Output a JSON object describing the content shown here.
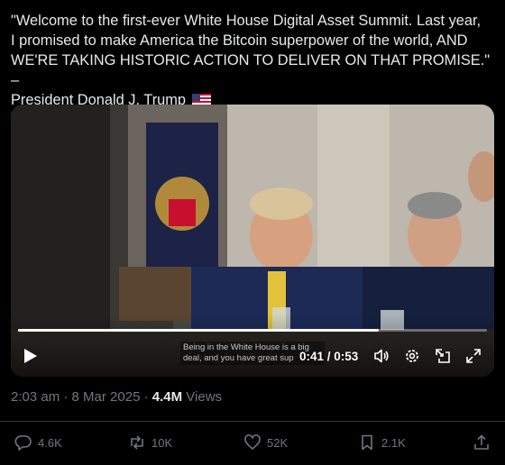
{
  "tweet": {
    "text_line1": "\"Welcome to the first-ever White House Digital Asset Summit. Last year,",
    "text_line2": "I promised to make America the Bitcoin superpower of the world, AND",
    "text_line3": "WE'RE TAKING HISTORIC ACTION TO DELIVER ON THAT PROMISE.\" –",
    "text_line4": "President Donald J. Trump",
    "flag_icon": "us-flag-icon"
  },
  "video": {
    "caption": "Being in the White House is a big deal, and you have great sup",
    "current_time": "0:41",
    "separator": " / ",
    "duration": "0:53",
    "progress": 0.77,
    "icons": [
      "play-icon",
      "volume-icon",
      "settings-icon",
      "fullscreen-exit-icon",
      "expand-icon"
    ]
  },
  "meta": {
    "time": "2:03 am",
    "dot1": " · ",
    "date": "8 Mar 2025",
    "dot2": " · ",
    "views": "4.4M",
    "views_label": " Views"
  },
  "actions": {
    "replies": "4.6K",
    "reposts": "10K",
    "likes": "52K",
    "bookmarks": "2.1K"
  },
  "colors": {
    "background": "#000000",
    "text": "#e7e9ea",
    "muted": "#71767b",
    "divider": "#2f3336"
  }
}
